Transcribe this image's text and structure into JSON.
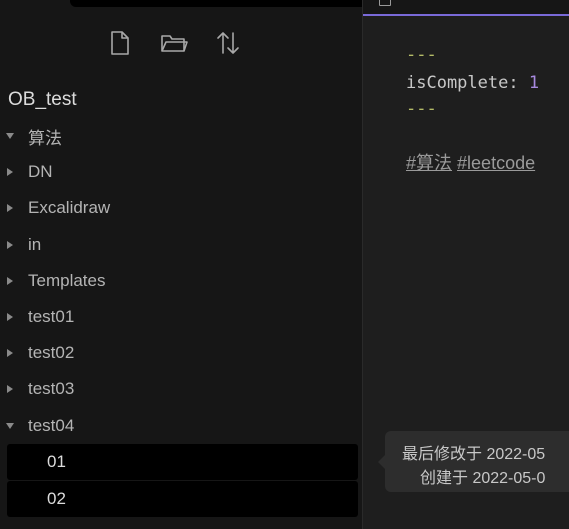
{
  "sidebar": {
    "toolbar": [
      {
        "icon": "new-note-icon"
      },
      {
        "icon": "new-folder-icon"
      },
      {
        "icon": "sort-icon"
      }
    ],
    "vault_name": "OB_test",
    "tree": [
      {
        "label": "算法",
        "expanded": true
      },
      {
        "label": "DN",
        "expanded": false
      },
      {
        "label": "Excalidraw",
        "expanded": false
      },
      {
        "label": "in",
        "expanded": false
      },
      {
        "label": "Templates",
        "expanded": false
      },
      {
        "label": "test01",
        "expanded": false
      },
      {
        "label": "test02",
        "expanded": false
      },
      {
        "label": "test03",
        "expanded": false
      },
      {
        "label": "test04",
        "expanded": true
      }
    ],
    "files": [
      {
        "label": "01"
      },
      {
        "label": "02"
      }
    ]
  },
  "editor": {
    "frontmatter_open": "---",
    "frontmatter_key": "isComplete",
    "frontmatter_sep": ": ",
    "frontmatter_value": "1",
    "frontmatter_close": "---",
    "tags": [
      "#算法",
      "#leetcode"
    ]
  },
  "tooltip": {
    "modified": "最后修改于 2022-05",
    "created": "创建于 2022-05-0"
  },
  "colors": {
    "sidebar_bg": "#161616",
    "editor_bg": "#1e1e1e",
    "accent": "#7a6ad8",
    "frontmatter_delim": "#b5bd68",
    "frontmatter_value": "#a88ae0"
  }
}
